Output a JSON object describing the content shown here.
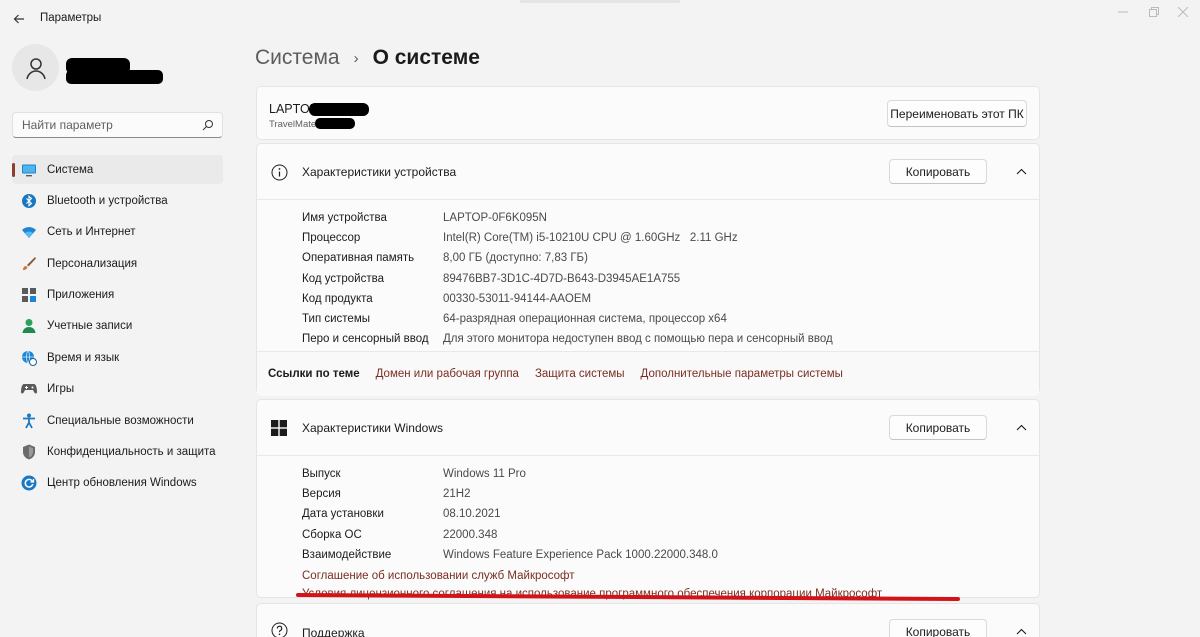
{
  "window": {
    "app_title": "Параметры"
  },
  "sidebar": {
    "search_placeholder": "Найти параметр",
    "items": [
      {
        "label": "Система",
        "icon": "display-icon",
        "active": true
      },
      {
        "label": "Bluetooth и устройства",
        "icon": "bluetooth-icon"
      },
      {
        "label": "Сеть и Интернет",
        "icon": "wifi-icon"
      },
      {
        "label": "Персонализация",
        "icon": "brush-icon"
      },
      {
        "label": "Приложения",
        "icon": "apps-icon"
      },
      {
        "label": "Учетные записи",
        "icon": "person-icon"
      },
      {
        "label": "Время и язык",
        "icon": "globe-clock-icon"
      },
      {
        "label": "Игры",
        "icon": "gamepad-icon"
      },
      {
        "label": "Специальные возможности",
        "icon": "accessibility-icon"
      },
      {
        "label": "Конфиденциальность и защита",
        "icon": "shield-icon"
      },
      {
        "label": "Центр обновления Windows",
        "icon": "update-icon"
      }
    ]
  },
  "breadcrumb": {
    "parent": "Система",
    "separator": "›",
    "current": "О системе"
  },
  "pc": {
    "name": "LAPTOP-",
    "model": "TravelMate",
    "rename_button": "Переименовать этот ПК"
  },
  "device_specs": {
    "title": "Характеристики устройства",
    "copy_button": "Копировать",
    "rows": [
      {
        "label": "Имя устройства",
        "value": "LAPTOP-0F6K095N"
      },
      {
        "label": "Процессор",
        "value": "Intel(R) Core(TM) i5-10210U CPU @ 1.60GHz   2.11 GHz"
      },
      {
        "label": "Оперативная память",
        "value": "8,00 ГБ (доступно: 7,83 ГБ)"
      },
      {
        "label": "Код устройства",
        "value": "89476BB7-3D1C-4D7D-B643-D3945AE1A755"
      },
      {
        "label": "Код продукта",
        "value": "00330-53011-94144-AAOEM"
      },
      {
        "label": "Тип системы",
        "value": "64-разрядная операционная система, процессор x64"
      },
      {
        "label": "Перо и сенсорный ввод",
        "value": "Для этого монитора недоступен ввод с помощью пера и сенсорный ввод"
      }
    ],
    "related_title": "Ссылки по теме",
    "related_links": [
      "Домен или рабочая группа",
      "Защита системы",
      "Дополнительные параметры системы"
    ]
  },
  "windows_specs": {
    "title": "Характеристики Windows",
    "copy_button": "Копировать",
    "rows": [
      {
        "label": "Выпуск",
        "value": "Windows 11 Pro"
      },
      {
        "label": "Версия",
        "value": "21H2"
      },
      {
        "label": "Дата установки",
        "value": "08.10.2021"
      },
      {
        "label": "Сборка ОС",
        "value": "22000.348"
      },
      {
        "label": "Взаимодействие",
        "value": "Windows Feature Experience Pack 1000.22000.348.0"
      }
    ],
    "links": [
      "Соглашение об использовании служб Майкрософт",
      "Условия лицензионного соглашения на использование программного обеспечения корпорации Майкрософт"
    ]
  },
  "support": {
    "title": "Поддержка",
    "copy_button": "Копировать"
  },
  "colors": {
    "accent": "#8c3d2e",
    "link": "#7a2e22",
    "annotation": "#d2131a"
  }
}
